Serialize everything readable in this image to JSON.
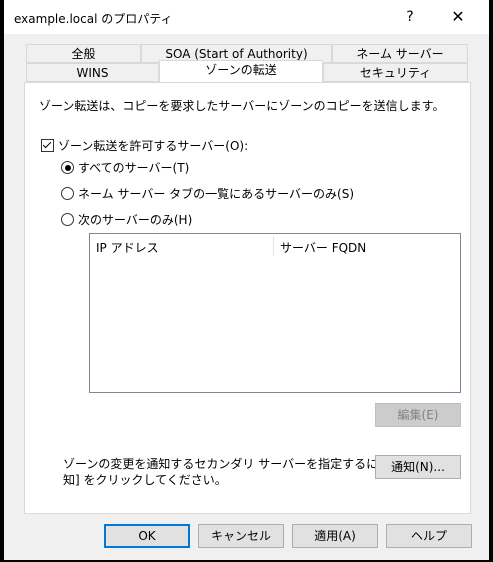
{
  "window": {
    "title": "example.local のプロパティ",
    "help_label": "?",
    "close_label": "✕"
  },
  "tabs_row1": [
    {
      "label": "全般"
    },
    {
      "label": "SOA (Start of Authority)"
    },
    {
      "label": "ネーム サーバー"
    }
  ],
  "tabs_row2": [
    {
      "label": "WINS"
    },
    {
      "label": "ゾーンの転送",
      "active": true
    },
    {
      "label": "セキュリティ"
    }
  ],
  "panel": {
    "description": "ゾーン転送は、コピーを要求したサーバーにゾーンのコピーを送信します。",
    "allow_checkbox_label": "ゾーン転送を許可するサーバー(O):",
    "allow_checked": true,
    "radio_options": [
      {
        "label": "すべてのサーバー(T)",
        "selected": true
      },
      {
        "label": "ネーム サーバー タブの一覧にあるサーバーのみ(S)",
        "selected": false
      },
      {
        "label": "次のサーバーのみ(H)",
        "selected": false
      }
    ],
    "list_columns": [
      "IP アドレス",
      "サーバー FQDN"
    ],
    "edit_button": "編集(E)",
    "notify_text_line1": "ゾーンの変更を通知するセカンダリ サーバーを指定するには、[通",
    "notify_text_line2": "知] をクリックしてください。",
    "notify_button": "通知(N)..."
  },
  "footer": {
    "ok": "OK",
    "cancel": "キャンセル",
    "apply": "適用(A)",
    "help": "ヘルプ"
  }
}
